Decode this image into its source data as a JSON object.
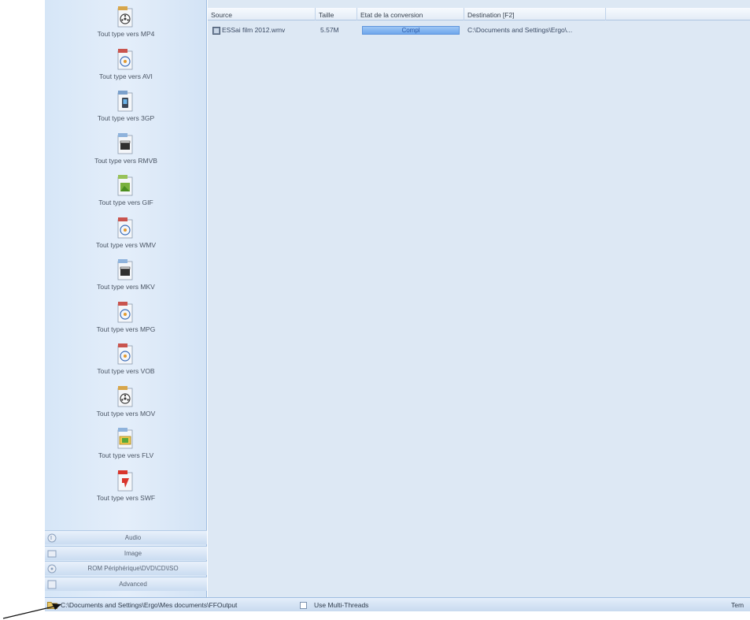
{
  "sidebar": {
    "items": [
      {
        "label": "Tout type vers MP4",
        "icon": "film-reel-file-icon"
      },
      {
        "label": "Tout type vers AVI",
        "icon": "disc-file-icon"
      },
      {
        "label": "Tout type vers 3GP",
        "icon": "phone-file-icon"
      },
      {
        "label": "Tout type vers RMVB",
        "icon": "clapper-file-icon"
      },
      {
        "label": "Tout type vers GIF",
        "icon": "image-file-icon"
      },
      {
        "label": "Tout type vers WMV",
        "icon": "disc-file-icon"
      },
      {
        "label": "Tout type vers MKV",
        "icon": "clapper-file-icon"
      },
      {
        "label": "Tout type vers MPG",
        "icon": "disc-file-icon"
      },
      {
        "label": "Tout type vers VOB",
        "icon": "disc-file-icon"
      },
      {
        "label": "Tout type vers MOV",
        "icon": "film-reel-file-icon"
      },
      {
        "label": "Tout type vers FLV",
        "icon": "flv-file-icon"
      },
      {
        "label": "Tout type vers SWF",
        "icon": "flash-file-icon"
      }
    ],
    "categories": [
      {
        "label": "Audio",
        "icon": "audio-icon"
      },
      {
        "label": "Image",
        "icon": "image-icon"
      },
      {
        "label": "ROM Périphérique\\DVD\\CD\\ISO",
        "icon": "disc-icon"
      },
      {
        "label": "Advanced",
        "icon": "advanced-icon"
      }
    ]
  },
  "list": {
    "columns": [
      "Source",
      "Taille",
      "Etat de la conversion",
      "Destination [F2]"
    ],
    "rows": [
      {
        "source": "ESSai film 2012.wmv",
        "size": "5.57M",
        "status": "Compl",
        "progress": 1.0,
        "destination": "C:\\Documents and Settings\\Ergo\\..."
      }
    ]
  },
  "statusbar": {
    "output_path": "C:\\Documents and Settings\\Ergo\\Mes documents\\FFOutput",
    "multithread_label": "Use Multi-Threads",
    "right_text": "Tem"
  },
  "colors": {
    "sidebar_bg": "#dbe8f6",
    "list_bg": "#dde8f4",
    "progress": "#6ea6ec"
  }
}
